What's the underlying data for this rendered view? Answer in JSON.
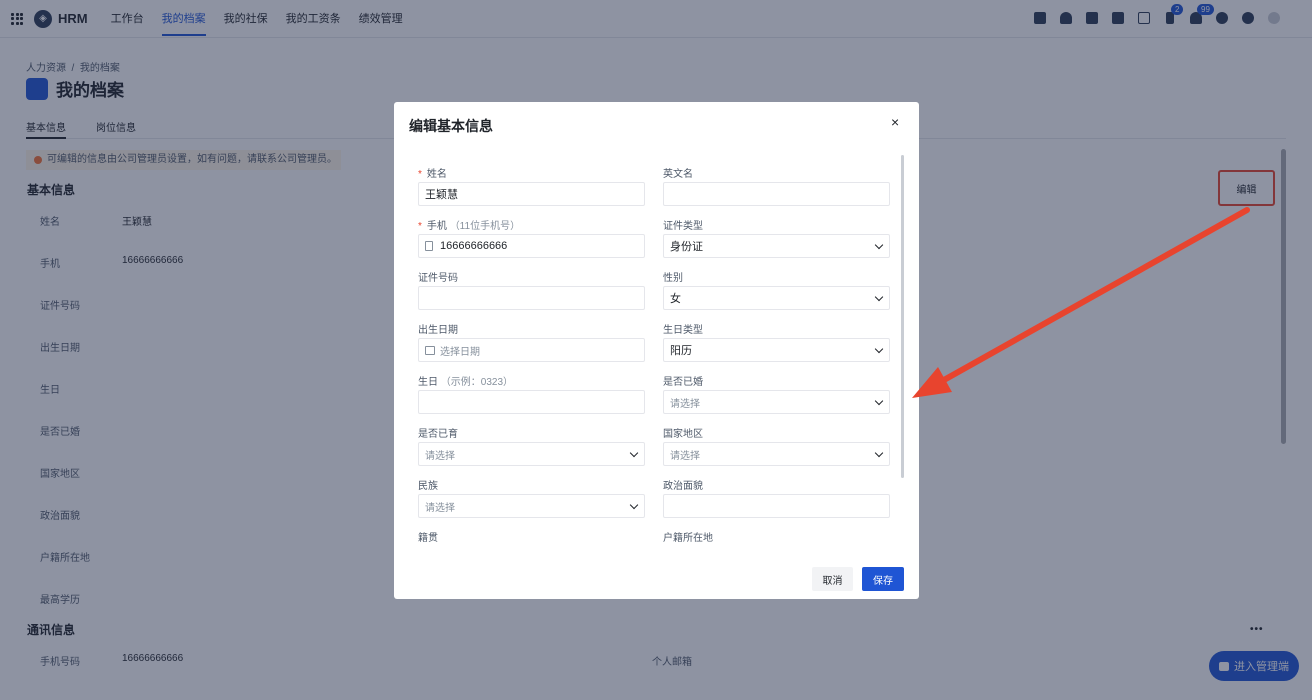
{
  "topbar": {
    "app_name": "HRM",
    "nav": [
      "工作台",
      "我的档案",
      "我的社保",
      "我的工资条",
      "绩效管理"
    ],
    "badges": {
      "flag": "2",
      "bell": "99"
    }
  },
  "page": {
    "breadcrumb": "人力资源  /  我的档案",
    "title": "我的档案",
    "tabs": [
      "基本信息",
      "岗位信息"
    ],
    "notice": "可编辑的信息由公司管理员设置，如有问题，请联系公司管理员。",
    "section_basic": "基本信息",
    "edit_label": "编辑",
    "basic_fields": [
      {
        "label": "姓名",
        "value": "王颖慧"
      },
      {
        "label": "手机",
        "value": "16666666666"
      },
      {
        "label": "证件号码",
        "value": ""
      },
      {
        "label": "出生日期",
        "value": ""
      },
      {
        "label": "生日",
        "value": ""
      },
      {
        "label": "是否已婚",
        "value": ""
      },
      {
        "label": "国家地区",
        "value": ""
      },
      {
        "label": "政治面貌",
        "value": ""
      },
      {
        "label": "户籍所在地",
        "value": ""
      },
      {
        "label": "最高学历",
        "value": ""
      }
    ],
    "section_contact": "通讯信息",
    "more": "•••",
    "contact_phone_label": "手机号码",
    "contact_phone_value": "16666666666",
    "contact_email_label": "个人邮箱",
    "admin_button": "进入管理端"
  },
  "modal": {
    "title": "编辑基本信息",
    "close": "×",
    "fields": {
      "name_label": "姓名",
      "name_value": "王颖慧",
      "english_name_label": "英文名",
      "phone_label": "手机",
      "phone_hint": "（11位手机号）",
      "phone_value": "16666666666",
      "id_type_label": "证件类型",
      "id_type_value": "身份证",
      "id_number_label": "证件号码",
      "gender_label": "性别",
      "gender_value": "女",
      "birth_date_label": "出生日期",
      "birth_date_placeholder": "选择日期",
      "birthday_type_label": "生日类型",
      "birthday_type_value": "阳历",
      "birthday_label": "生日",
      "birthday_hint": "（示例：0323）",
      "married_label": "是否已婚",
      "married_value": "请选择",
      "children_label": "是否已育",
      "children_value": "请选择",
      "country_label": "国家地区",
      "country_value": "请选择",
      "ethnicity_label": "民族",
      "ethnicity_value": "请选择",
      "political_label": "政治面貌",
      "native_place_label": "籍贯",
      "household_label": "户籍所在地"
    },
    "cancel": "取消",
    "save": "保存"
  },
  "colors": {
    "primary": "#1f55d4",
    "annotation": "#e8442e"
  }
}
